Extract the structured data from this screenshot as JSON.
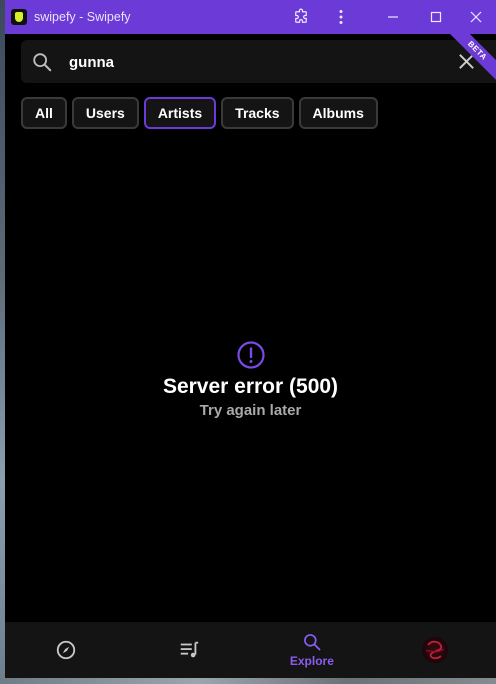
{
  "window": {
    "title": "swipefy - Swipefy"
  },
  "titlebar": {
    "icons": [
      "extension-icon",
      "more-vert-icon",
      "minimize-icon",
      "maximize-icon",
      "close-icon"
    ]
  },
  "search": {
    "value": "gunna",
    "placeholder": "",
    "badge": "BETA"
  },
  "filters": [
    {
      "label": "All",
      "active": false
    },
    {
      "label": "Users",
      "active": false
    },
    {
      "label": "Artists",
      "active": true
    },
    {
      "label": "Tracks",
      "active": false
    },
    {
      "label": "Albums",
      "active": false
    }
  ],
  "error": {
    "title": "Server error (500)",
    "subtitle": "Try again later"
  },
  "nav": {
    "items": [
      {
        "icon": "compass-icon",
        "label": ""
      },
      {
        "icon": "queue-music-icon",
        "label": ""
      },
      {
        "icon": "search-icon",
        "label": "Explore",
        "active": true
      },
      {
        "icon": "avatar",
        "label": ""
      }
    ]
  },
  "colors": {
    "accent": "#6c3ad6",
    "background": "#000000",
    "surface": "#141414"
  }
}
